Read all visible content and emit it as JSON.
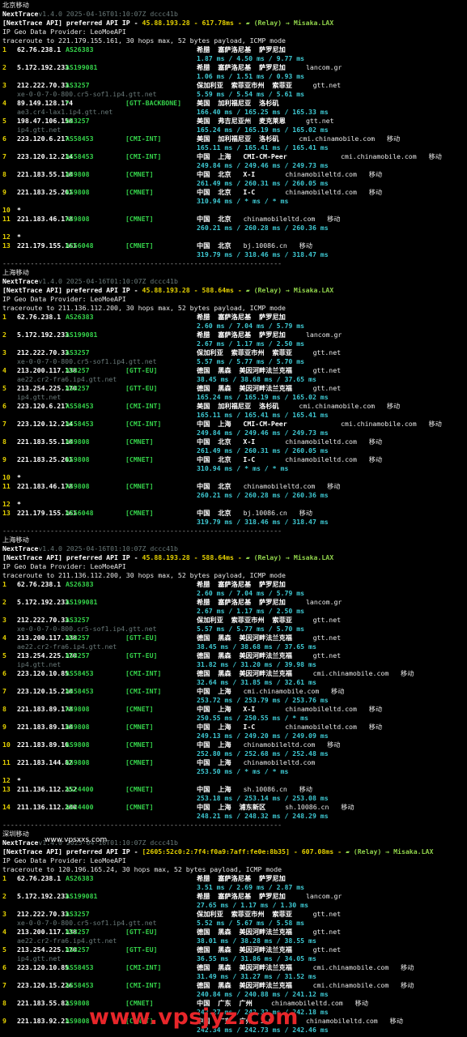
{
  "sections": [
    {
      "title": "北京移动",
      "version": "v1.4.0 2025-04-16T01:10:07Z dccc41b",
      "api_prefix": "[NextTrace API] preferred API IP - ",
      "api_ip": "45.88.193.28",
      "api_ms": " - 617.78ms - ",
      "relay": "(Relay) → Misaka.LAX",
      "geo": "IP Geo Data Provider: LeoMoeAPI",
      "traceroute": "traceroute to 221.179.155.161, 30 hops max, 52 bytes payload, ICMP mode",
      "hops": [
        {
          "n": "1",
          "ip": "62.76.238.1",
          "as": "AS26383",
          "tag": "",
          "loc": "希腊  塞萨洛尼基  萨罗尼加",
          "org": "",
          "lat": "1.87 ms / 4.50 ms / 9.77 ms",
          "host": ""
        },
        {
          "n": "2",
          "ip": "5.172.192.233",
          "as": "AS199081",
          "tag": "",
          "loc": "希腊  塞萨洛尼基  萨罗尼加",
          "org": "lancom.gr",
          "lat": "1.06 ms / 1.51 ms / 0.93 ms",
          "host": ""
        },
        {
          "n": "3",
          "ip": "212.222.70.33",
          "as": "AS3257",
          "tag": "",
          "loc": "保加利亚  索菲亚市州  索菲亚",
          "org": "gtt.net",
          "lat": "5.59 ms / 5.54 ms / 5.61 ms",
          "host": "xe-0-0-7-0-800.cr5-sof1.ip4.gtt.net"
        },
        {
          "n": "4",
          "ip": "89.149.128.174",
          "as": "*",
          "tag": "[GTT-BACKBONE]",
          "loc": "美国  加利福尼亚  洛杉矶",
          "org": "",
          "lat": "166.40 ms / 165.25 ms / 165.33 ms",
          "host": "ae3.cr4-lax1.ip4.gtt.net"
        },
        {
          "n": "5",
          "ip": "198.47.106.150",
          "as": "AS3257",
          "tag": "",
          "loc": "美国  弗吉尼亚州  麦克莱恩",
          "org": "gtt.net",
          "lat": "165.24 ms / 165.19 ms / 165.02 ms",
          "host": "ip4.gtt.net"
        },
        {
          "n": "6",
          "ip": "223.120.6.217",
          "as": "AS58453",
          "tag": "[CMI-INT]",
          "loc": "美国  加利福尼亚  洛杉矶",
          "org": "cmi.chinamobile.com   移动",
          "lat": "165.11 ms / 165.41 ms / 165.41 ms",
          "host": ""
        },
        {
          "n": "7",
          "ip": "223.120.12.214",
          "as": "AS58453",
          "tag": "[CMI-INT]",
          "loc": "中国  上海   CMI-CM-Peer",
          "org": "cmi.chinamobile.com   移动",
          "lat": "249.84 ms / 249.46 ms / 249.73 ms",
          "host": ""
        },
        {
          "n": "8",
          "ip": "221.183.55.110",
          "as": "AS9808",
          "tag": "[CMNET]",
          "loc": "中国  北京   X-I",
          "org": "chinamobileltd.com   移动",
          "lat": "261.49 ms / 260.31 ms / 260.05 ms",
          "host": ""
        },
        {
          "n": "9",
          "ip": "221.183.25.201",
          "as": "AS9808",
          "tag": "[CMNET]",
          "loc": "中国  北京   I-C",
          "org": "chinamobileltd.com   移动",
          "lat": "310.94 ms / * ms / * ms",
          "host": ""
        },
        {
          "n": "10",
          "ip": "*",
          "as": "",
          "tag": "",
          "loc": "",
          "org": "",
          "lat": "",
          "host": ""
        },
        {
          "n": "11",
          "ip": "221.183.46.178",
          "as": "AS9808",
          "tag": "[CMNET]",
          "loc": "中国  北京",
          "org": "chinamobileltd.com   移动",
          "lat": "260.21 ms / 260.28 ms / 260.36 ms",
          "host": ""
        },
        {
          "n": "12",
          "ip": "*",
          "as": "",
          "tag": "",
          "loc": "",
          "org": "",
          "lat": "",
          "host": ""
        },
        {
          "n": "13",
          "ip": "221.179.155.161",
          "as": "AS56048",
          "tag": "[CMNET]",
          "loc": "中国  北京",
          "org": "bj.10086.cn   移动",
          "lat": "319.79 ms / 318.46 ms / 318.47 ms",
          "host": ""
        }
      ]
    },
    {
      "title": "上海移动",
      "version": "v1.4.0 2025-04-16T01:10:07Z dccc41b",
      "api_prefix": "[NextTrace API] preferred API IP - ",
      "api_ip": "45.88.193.28",
      "api_ms": " - 588.64ms - ",
      "relay": "(Relay) → Misaka.LAX",
      "geo": "IP Geo Data Provider: LeoMoeAPI",
      "traceroute": "traceroute to 211.136.112.200, 30 hops max, 52 bytes payload, ICMP mode",
      "hops": [
        {
          "n": "1",
          "ip": "62.76.238.1",
          "as": "AS26383",
          "tag": "",
          "loc": "希腊  塞萨洛尼基  萨罗尼加",
          "org": "",
          "lat": "2.60 ms / 7.04 ms / 5.79 ms",
          "host": ""
        },
        {
          "n": "2",
          "ip": "5.172.192.233",
          "as": "AS199081",
          "tag": "",
          "loc": "希腊  塞萨洛尼基  萨罗尼加",
          "org": "lancom.gr",
          "lat": "2.67 ms / 1.17 ms / 2.50 ms",
          "host": ""
        },
        {
          "n": "3",
          "ip": "212.222.70.33",
          "as": "AS3257",
          "tag": "",
          "loc": "保加利亚  索菲亚市州  索菲亚",
          "org": "gtt.net",
          "lat": "5.57 ms / 5.77 ms / 5.70 ms",
          "host": "xe-0-0-7-0-800.cr5-sof1.ip4.gtt.net"
        },
        {
          "n": "4",
          "ip": "213.200.117.138",
          "as": "AS3257",
          "tag": "[GTT-EU]",
          "loc": "德国  黑森  美因河畔法兰克福",
          "org": "gtt.net",
          "lat": "38.45 ms / 38.68 ms / 37.65 ms",
          "host": "ae22.cr2-fra6.ip4.gtt.net"
        },
        {
          "n": "5",
          "ip": "213.254.225.170",
          "as": "AS3257",
          "tag": "[GTT-EU]",
          "loc": "德国  黑森  美因河畔法兰克福",
          "org": "gtt.net",
          "lat": "165.24 ms / 165.19 ms / 165.02 ms",
          "host": "ip4.gtt.net"
        },
        {
          "n": "6",
          "ip": "223.120.6.217",
          "as": "AS58453",
          "tag": "[CMI-INT]",
          "loc": "美国  加利福尼亚  洛杉矶",
          "org": "cmi.chinamobile.com   移动",
          "lat": "165.11 ms / 165.41 ms / 165.41 ms",
          "host": ""
        },
        {
          "n": "7",
          "ip": "223.120.12.214",
          "as": "AS58453",
          "tag": "[CMI-INT]",
          "loc": "中国  上海   CMI-CM-Peer",
          "org": "cmi.chinamobile.com   移动",
          "lat": "249.84 ms / 249.46 ms / 249.73 ms",
          "host": ""
        },
        {
          "n": "8",
          "ip": "221.183.55.110",
          "as": "AS9808",
          "tag": "[CMNET]",
          "loc": "中国  北京   X-I",
          "org": "chinamobileltd.com   移动",
          "lat": "261.49 ms / 260.31 ms / 260.05 ms",
          "host": ""
        },
        {
          "n": "9",
          "ip": "221.183.25.201",
          "as": "AS9808",
          "tag": "[CMNET]",
          "loc": "中国  北京   I-C",
          "org": "chinamobileltd.com   移动",
          "lat": "310.94 ms / * ms / * ms",
          "host": ""
        },
        {
          "n": "10",
          "ip": "*",
          "as": "",
          "tag": "",
          "loc": "",
          "org": "",
          "lat": "",
          "host": ""
        },
        {
          "n": "11",
          "ip": "221.183.46.178",
          "as": "AS9808",
          "tag": "[CMNET]",
          "loc": "中国  北京",
          "org": "chinamobileltd.com   移动",
          "lat": "260.21 ms / 260.28 ms / 260.36 ms",
          "host": ""
        },
        {
          "n": "12",
          "ip": "*",
          "as": "",
          "tag": "",
          "loc": "",
          "org": "",
          "lat": "",
          "host": ""
        },
        {
          "n": "13",
          "ip": "221.179.155.161",
          "as": "AS56048",
          "tag": "[CMNET]",
          "loc": "中国  北京",
          "org": "bj.10086.cn   移动",
          "lat": "319.79 ms / 318.46 ms / 318.47 ms",
          "host": ""
        }
      ]
    },
    {
      "title": "上海移动",
      "version": "v1.4.0 2025-04-16T01:10:07Z dccc41b",
      "api_prefix": "[NextTrace API] preferred API IP - ",
      "api_ip": "45.88.193.28",
      "api_ms": " - 588.64ms - ",
      "relay": "(Relay) → Misaka.LAX",
      "geo": "IP Geo Data Provider: LeoMoeAPI",
      "traceroute": "traceroute to 211.136.112.200, 30 hops max, 52 bytes payload, ICMP mode",
      "hops": [
        {
          "n": "1",
          "ip": "62.76.238.1",
          "as": "AS26383",
          "tag": "",
          "loc": "希腊  塞萨洛尼基  萨罗尼加",
          "org": "",
          "lat": "2.60 ms / 7.04 ms / 5.79 ms",
          "host": ""
        },
        {
          "n": "2",
          "ip": "5.172.192.233",
          "as": "AS199081",
          "tag": "",
          "loc": "希腊  塞萨洛尼基  萨罗尼加",
          "org": "lancom.gr",
          "lat": "2.67 ms / 1.17 ms / 2.50 ms",
          "host": ""
        },
        {
          "n": "3",
          "ip": "212.222.70.33",
          "as": "AS3257",
          "tag": "",
          "loc": "保加利亚  索菲亚市州  索菲亚",
          "org": "gtt.net",
          "lat": "5.57 ms / 5.77 ms / 5.70 ms",
          "host": "xe-0-0-7-0-800.cr5-sof1.ip4.gtt.net"
        },
        {
          "n": "4",
          "ip": "213.200.117.138",
          "as": "AS3257",
          "tag": "[GTT-EU]",
          "loc": "德国  黑森  美因河畔法兰克福",
          "org": "gtt.net",
          "lat": "38.45 ms / 38.68 ms / 37.65 ms",
          "host": "ae22.cr2-fra6.ip4.gtt.net"
        },
        {
          "n": "5",
          "ip": "213.254.225.170",
          "as": "AS3257",
          "tag": "[GTT-EU]",
          "loc": "德国  黑森  美因河畔法兰克福",
          "org": "gtt.net",
          "lat": "31.82 ms / 31.20 ms / 39.98 ms",
          "host": "ip4.gtt.net"
        },
        {
          "n": "6",
          "ip": "223.120.10.85",
          "as": "AS58453",
          "tag": "[CMI-INT]",
          "loc": "德国  黑森  美因河畔法兰克福",
          "org": "cmi.chinamobile.com   移动",
          "lat": "32.64 ms / 31.85 ms / 32.61 ms",
          "host": ""
        },
        {
          "n": "7",
          "ip": "223.120.15.210",
          "as": "AS58453",
          "tag": "[CMI-INT]",
          "loc": "中国  上海",
          "org": "cmi.chinamobile.com   移动",
          "lat": "253.72 ms / 253.79 ms / 253.76 ms",
          "host": ""
        },
        {
          "n": "8",
          "ip": "221.183.89.178",
          "as": "AS9808",
          "tag": "[CMNET]",
          "loc": "中国  上海   X-I",
          "org": "chinamobileltd.com   移动",
          "lat": "250.55 ms / 250.55 ms / * ms",
          "host": ""
        },
        {
          "n": "9",
          "ip": "221.183.89.130",
          "as": "AS9808",
          "tag": "[CMNET]",
          "loc": "中国  上海   I-C",
          "org": "chinamobileltd.com   移动",
          "lat": "249.13 ms / 249.20 ms / 249.09 ms",
          "host": ""
        },
        {
          "n": "10",
          "ip": "221.183.89.10",
          "as": "AS9808",
          "tag": "[CMNET]",
          "loc": "中国  上海",
          "org": "chinamobileltd.com   移动",
          "lat": "252.80 ms / 252.68 ms / 252.48 ms",
          "host": ""
        },
        {
          "n": "11",
          "ip": "221.183.144.82",
          "as": "AS9808",
          "tag": "[CMNET]",
          "loc": "中国  上海",
          "org": "chinamobileltd.com",
          "lat": "253.50 ms / * ms / * ms",
          "host": ""
        },
        {
          "n": "12",
          "ip": "*",
          "as": "",
          "tag": "",
          "loc": "",
          "org": "",
          "lat": "",
          "host": ""
        },
        {
          "n": "13",
          "ip": "211.136.112.252",
          "as": "AS24400",
          "tag": "[CMNET]",
          "loc": "中国  上海",
          "org": "sh.10086.cn   移动",
          "lat": "253.18 ms / 253.14 ms / 253.08 ms",
          "host": ""
        },
        {
          "n": "14",
          "ip": "211.136.112.200",
          "as": "AS24400",
          "tag": "[CMNET]",
          "loc": "中国  上海  浦东新区",
          "org": "sh.10086.cn   移动",
          "lat": "248.21 ms / 248.32 ms / 248.29 ms",
          "host": ""
        }
      ]
    },
    {
      "title": "深圳移动",
      "version": "v1.4.0 2025-04-16T01:10:07Z dccc41b",
      "api_prefix": "[NextTrace API] preferred API IP - ",
      "api_ip": "[2605:52c0:2:7f4:f0a9:7aff:fe0e:8b35]",
      "api_ms": " - 607.08ms - ",
      "relay": "(Relay) → Misaka.LAX",
      "geo": "IP Geo Data Provider: LeoMoeAPI",
      "traceroute": "traceroute to 120.196.165.24, 30 hops max, 52 bytes payload, ICMP mode",
      "hops": [
        {
          "n": "1",
          "ip": "62.76.238.1",
          "as": "AS26383",
          "tag": "",
          "loc": "希腊  塞萨洛尼基  萨罗尼加",
          "org": "",
          "lat": "3.51 ms / 2.69 ms / 2.87 ms",
          "host": ""
        },
        {
          "n": "2",
          "ip": "5.172.192.233",
          "as": "AS199081",
          "tag": "",
          "loc": "希腊  塞萨洛尼基  萨罗尼加",
          "org": "lancom.gr",
          "lat": "27.65 ms / 1.17 ms / 1.30 ms",
          "host": ""
        },
        {
          "n": "3",
          "ip": "212.222.70.33",
          "as": "AS3257",
          "tag": "",
          "loc": "保加利亚  索菲亚市州  索菲亚",
          "org": "gtt.net",
          "lat": "5.52 ms / 5.67 ms / 5.58 ms",
          "host": "xe-0-0-7-0-800.cr5-sof1.ip4.gtt.net"
        },
        {
          "n": "4",
          "ip": "213.200.117.138",
          "as": "AS3257",
          "tag": "[GTT-EU]",
          "loc": "德国  黑森  美因河畔法兰克福",
          "org": "gtt.net",
          "lat": "38.01 ms / 38.28 ms / 38.55 ms",
          "host": "ae22.cr2-fra6.ip4.gtt.net"
        },
        {
          "n": "5",
          "ip": "213.254.225.170",
          "as": "AS3257",
          "tag": "[GTT-EU]",
          "loc": "德国  黑森  美因河畔法兰克福",
          "org": "gtt.net",
          "lat": "36.55 ms / 31.86 ms / 34.05 ms",
          "host": "ip4.gtt.net"
        },
        {
          "n": "6",
          "ip": "223.120.10.85",
          "as": "AS58453",
          "tag": "[CMI-INT]",
          "loc": "德国  黑森  美因河畔法兰克福",
          "org": "cmi.chinamobile.com   移动",
          "lat": "31.49 ms / 31.27 ms / 31.52 ms",
          "host": ""
        },
        {
          "n": "7",
          "ip": "223.120.15.226",
          "as": "AS58453",
          "tag": "[CMI-INT]",
          "loc": "德国  黑森  美因河畔法兰克福",
          "org": "cmi.chinamobile.com   移动",
          "lat": "240.84 ms / 240.88 ms / 241.12 ms",
          "host": ""
        },
        {
          "n": "8",
          "ip": "221.183.55.82",
          "as": "AS9808",
          "tag": "[CMNET]",
          "loc": "中国  广东  广州",
          "org": "chinamobileltd.com   移动",
          "lat": "242.27 ms / 242.32 ms / 242.18 ms",
          "host": ""
        },
        {
          "n": "9",
          "ip": "221.183.92.21",
          "as": "AS9808",
          "tag": "[CMNET]",
          "loc": "中国  广东  广州  I-C",
          "org": "chinamobileltd.com   移动",
          "lat": "242.34 ms / 242.73 ms / 242.46 ms",
          "host": ""
        }
      ]
    }
  ],
  "separator": "----------------------------------------------------------------------",
  "brand": "NextTrace",
  "watermark_small": "www.vpsxxs.com",
  "watermark_large": "www.vpsjyz.com",
  "colors": {
    "version": "#6a7a7a",
    "api_ip": "#e6d200",
    "relay": "#8fd14a",
    "latency": "#3ec8d2",
    "asn": "#35d24a",
    "watermark": "#e8262a"
  }
}
